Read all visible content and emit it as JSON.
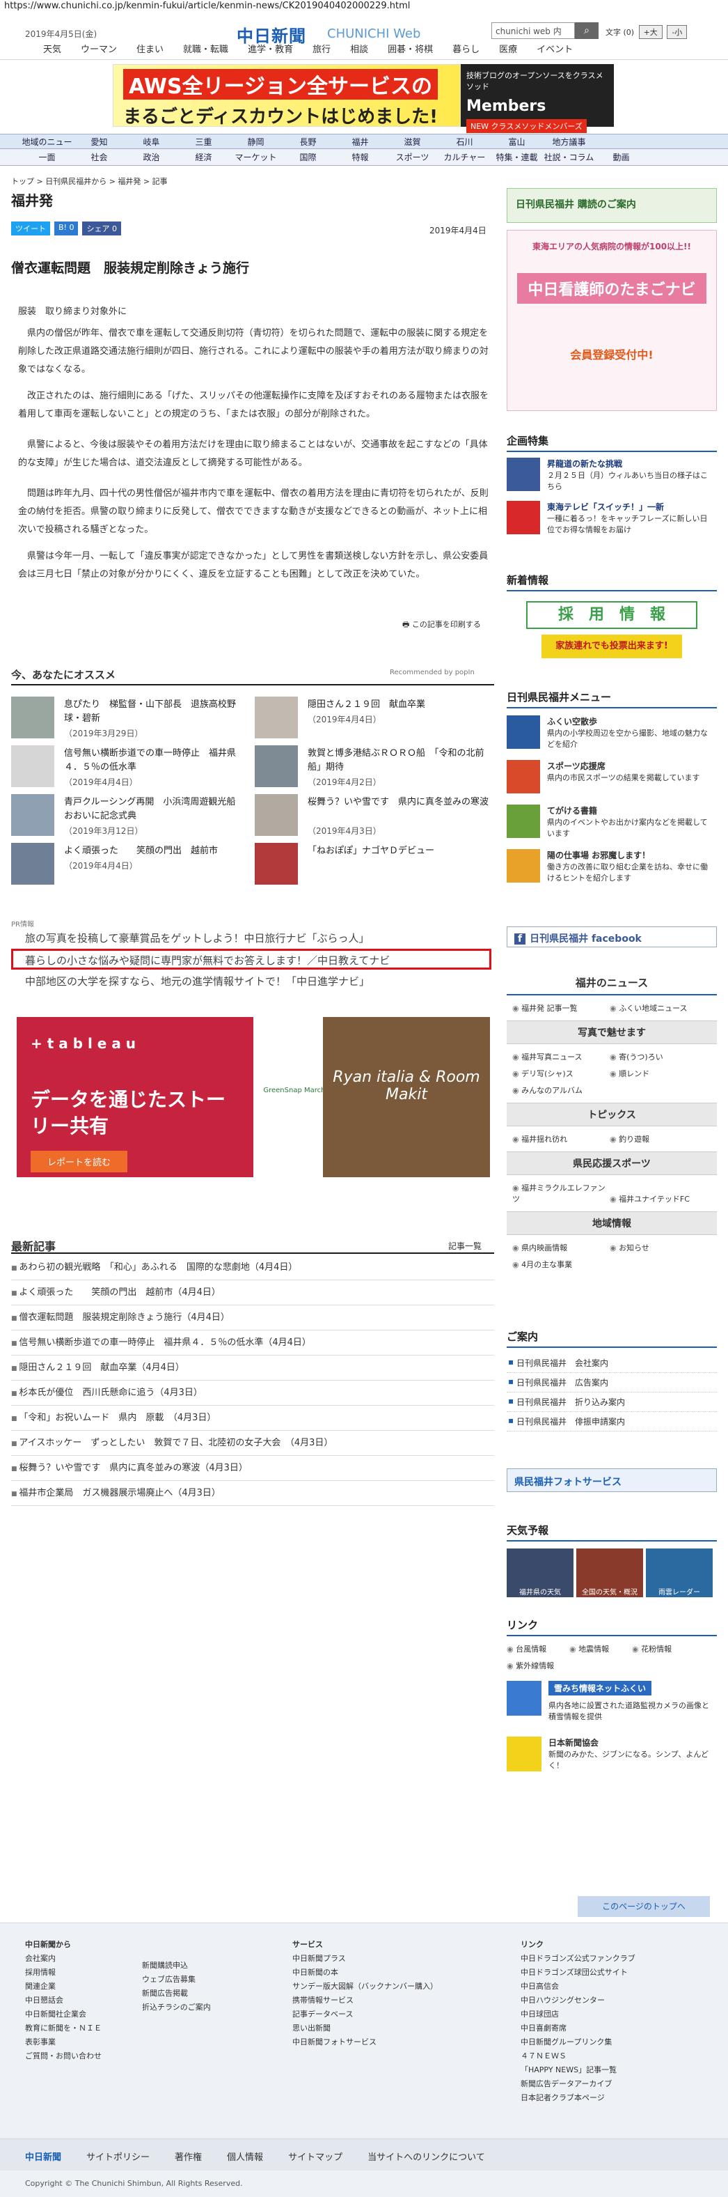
{
  "url": "https://www.chunichi.co.jp/kenmin-fukui/article/kenmin-news/CK2019040402000229.html",
  "header": {
    "date": "2019年4月5日(金)",
    "logo": "中日新聞",
    "logo_sub": "CHUNICHI Web",
    "search_placeholder": "chunichi web 内",
    "search_icon": "search-icon",
    "fontsize_label": "文字",
    "fontsize_current": "(0)",
    "fontsize_plus": "+大",
    "fontsize_minus": "-小",
    "nav": [
      "天気",
      "ウーマン",
      "住まい",
      "就職・転職",
      "進学・教育",
      "旅行",
      "相談",
      "囲碁・将棋",
      "暮らし",
      "医療",
      "イベント"
    ]
  },
  "banner": {
    "line1": "AWS全リージョン全サービスの",
    "line2": "まるごとディスカウントはじめました!",
    "r1": "技術ブログのオープンソースをクラスメソッド",
    "r2": "Members",
    "r3": "NEW クラスメソッドメンバーズ",
    "accent": "#e52b18"
  },
  "catnav1": [
    "地域のニュース",
    "愛知",
    "岐阜",
    "三重",
    "静岡",
    "長野",
    "福井",
    "滋賀",
    "石川",
    "富山",
    "地方議事"
  ],
  "catnav2": [
    "一面",
    "社会",
    "政治",
    "経済",
    "マーケット",
    "国際",
    "特報",
    "スポーツ",
    "カルチャー",
    "特集・連載",
    "社説・コラム",
    "動画"
  ],
  "breadcrumb": "トップ > 日刊県民福井から > 福井発 > 記事",
  "section_title": "福井発",
  "share": {
    "tweet": "ツイート",
    "hatena": "B! 0",
    "facebook": "シェア 0"
  },
  "article": {
    "date": "2019年4月4日",
    "headline": "僧衣運転問題　服装規定削除きょう施行",
    "subhead": "服装　取り締まり対象外に",
    "paragraphs": [
      "県内の僧侶が昨年、僧衣で車を運転して交通反則切符（青切符）を切られた問題で、運転中の服装に関する規定を削除した改正県道路交通法施行細則が四日、施行される。これにより運転中の服装や手の着用方法が取り締まりの対象ではなくなる。",
      "改正されたのは、施行細則にある「げた、スリッパその他運転操作に支障を及ぼすおそれのある履物または衣服を着用して車両を運転しないこと」との規定のうち、「または衣服」の部分が削除された。",
      "県警によると、今後は服装やその着用方法だけを理由に取り締まることはないが、交通事故を起こすなどの「具体的な支障」が生じた場合は、道交法違反として摘発する可能性がある。",
      "問題は昨年九月、四十代の男性僧侶が福井市内で車を運転中、僧衣の着用方法を理由に青切符を切られたが、反則金の納付を拒否。県警の取り締まりに反発して、僧衣でできますな動きが支援などできるとの動画が、ネット上に相次いで投稿される騒ぎとなった。",
      "県警は今年一月、一転して「違反事実が認定できなかった」として男性を書類送検しない方針を示し、県公安委員会は三月七日「禁止の対象が分かりにくく、違反を立証することも困難」として改正を決めていた。"
    ],
    "print": "この記事を印刷する"
  },
  "recommend": {
    "title": "今、あなたにオススメ",
    "by": "Recommended by popIn",
    "items": [
      {
        "title": "息ぴたり　梯監督・山下部長　退族高校野球・碧新",
        "date": "（2019年3月29日）"
      },
      {
        "title": "隠田さん２１９回　献血卒業",
        "date": "（2019年4月4日）"
      },
      {
        "title": "信号無い横断歩道での車一時停止　福井県４．５％の低水準",
        "date": "（2019年4月4日）"
      },
      {
        "title": "敦賀と博多港結ぶＲＯＲＯ船　「令和の北前船」期待",
        "date": "（2019年4月2日）"
      },
      {
        "title": "青戸クルーシング再開　小浜湾周遊観光船　おおいに記念式典",
        "date": "（2019年3月12日）"
      },
      {
        "title": "桜舞う？いや雪です　県内に真冬並みの寒波",
        "date": "（2019年4月3日）"
      },
      {
        "title": "よく頑張った　　笑顔の門出　越前市",
        "date": "（2019年4月4日）"
      },
      {
        "title": "「ねおぽぽ」ナゴヤＤデビュー",
        "date": ""
      }
    ]
  },
  "pr": {
    "label": "PR情報",
    "items": [
      "旅の写真を投稿して豪華賞品をゲットしよう！中日旅行ナビ「ぶらっ人」",
      "暮らしの小さな悩みや疑問に専門家が無料でお答えします！／中日教えてナビ",
      "中部地区の大学を探すなら、地元の進学情報サイトで！「中日進学ナビ」"
    ]
  },
  "ads": {
    "a1_brand": "+ t a b l e a u",
    "a1_text": "データを通じたストーリー共有",
    "a1_btn": "レポートを読む",
    "a2_text": "GreenSnap Marche",
    "a3_text": "Ryan italia & Room Makit"
  },
  "latest": {
    "title": "最新記事",
    "more": "記事一覧",
    "items": [
      "あわら初の観光戦略　「和心」あふれる　国際的な悲劇地（4月4日）",
      "よく頑張った　　笑顔の門出　越前市（4月4日）",
      "僧衣運転問題　服装規定削除きょう施行（4月4日）",
      "信号無い横断歩道での車一時停止　福井県４．５％の低水準（4月4日）",
      "隠田さん２１９回　献血卒業（4月4日）",
      "杉本氏が優位　西川氏懸命に追う（4月3日）",
      "「令和」お祝いムード　県内　原載　（4月3日）",
      "アイスホッケー　ずっとしたい　敦賀で７日、北陸初の女子大会　（4月3日）",
      "桜舞う？いや雪です　県内に真冬並みの寒波（4月3日）",
      "福井市企業局　ガス機器展示場廃止へ（4月3日）"
    ]
  },
  "sidebar": {
    "subscribe": "日刊県民福井 購読のご案内",
    "nurse_ad": "中日看護師のたまごナビ",
    "nurse_sub": "東海エリアの人気病院の情報が100以上!!",
    "nurse_reg": "会員登録受付中!",
    "kikaku_title": "企画特集",
    "kikaku_items": [
      {
        "title": "昇龍道の新たな挑戦",
        "desc": "２月２５日（月）ウィルあいち当日の様子はこちら"
      },
      {
        "title": "東海テレビ「スイッチ！」一新",
        "desc": "一種に着るっ！をキャッチフレーズに新しい日位でお得な情報をお届け"
      }
    ],
    "recruit_title": "新着情報",
    "recruit_text": "採　用　情　報",
    "recruit_sub": "家族連れでも投票出来ます!",
    "menu_title": "日刊県民福井メニュー",
    "menu_items": [
      {
        "title": "ふくい空散歩",
        "desc": "県内の小学校周辺を空から撮影、地域の魅力などを紹介"
      },
      {
        "title": "スポーツ応援席",
        "desc": "県内の市民スポーツの結果を掲載しています"
      },
      {
        "title": "てがける書籍",
        "desc": "県内のイベントやお出かけ案内などを掲載しています"
      },
      {
        "title": "陽の仕事場 お邪魔します！",
        "desc": "働き方の改善に取り組む企業を訪ね、幸せに働けるヒントを紹介します"
      }
    ],
    "facebook": "日刊県民福井 facebook",
    "fukui_news": "福井のニュース",
    "fukui_chk": [
      "福井発 記事一覧",
      "ふくい地域ニュース"
    ],
    "photo_title": "写真で魅せます",
    "photo_chk": [
      "福井写真ニュース",
      "寄(うつ)ろい",
      "デリ写(シャ)ス",
      "順レンド",
      "みんなのアルバム"
    ],
    "topics_title": "トピックス",
    "topics_chk": [
      "福井揺れ彷れ",
      "釣り遊報"
    ],
    "sports_title": "県民応援スポーツ",
    "sports_chk": [
      "福井ミラクルエレファンツ",
      "福井ユナイテッドFC"
    ],
    "region_title": "地域情報",
    "region_chk": [
      "県内映画情報",
      "お知らせ",
      "4月の主な事業"
    ],
    "guide_title": "ご案内",
    "guide_items": [
      "日刊県民福井　会社案内",
      "日刊県民福井　広告案内",
      "日刊県民福井　折り込み案内",
      "日刊県民福井　俳振申請案内"
    ],
    "photo_service": "県民福井フォトサービス",
    "weather_title": "天気予報",
    "weather_imgs": [
      "福井県の天気",
      "全国の天気・概況",
      "雨雲レーダー"
    ],
    "link_title": "リンク",
    "link_chk": [
      "台風情報",
      "地震情報",
      "花粉情報",
      "紫外線情報"
    ],
    "road_title": "雪みち情報ネットふくい",
    "road_desc": "県内各地に設置された道路監視カメラの画像と積雪情報を提供",
    "jnpa_title": "日本新聞協会",
    "jnpa_desc": "新聞のみかた、ジブンになる。シンプ、よんどく！"
  },
  "footer": {
    "totop": "このページのトップへ",
    "col1_title": "中日新聞から",
    "col1": [
      "会社案内",
      "採用情報",
      "関連企業",
      "中日懇話会",
      "中日新聞社企業会",
      "教育に新聞を・ＮＩＥ",
      "表彰事業",
      "ご質問・お問い合わせ"
    ],
    "col2": [
      "新聞購読申込",
      "ウェブ広告募集",
      "新聞広告掲載",
      "折込チラシのご案内"
    ],
    "col3_title": "サービス",
    "col3": [
      "中日新聞プラス",
      "中日新聞の本",
      "サンデー版大図解（バックナンバー購入）",
      "携帯情報サービス",
      "記事データベース",
      "思い出新聞",
      "中日新聞フォトサービス"
    ],
    "col4_title": "リンク",
    "col4": [
      "中日ドラゴンズ公式ファンクラブ",
      "中日ドラゴンズ球団公式サイト",
      "中日高信会",
      "中日ハウジングセンター",
      "中日球団店",
      "中日喜劇寄席",
      "中日新聞グループリンク集",
      "４７ＮＥＷＳ",
      "「HAPPY NEWS」記事一覧",
      "新聞広告データアーカイブ",
      "日本記者クラブ本ページ"
    ],
    "bar_logo": "中日新聞",
    "bar_links": [
      "サイトポリシー",
      "著作権",
      "個人情報",
      "サイトマップ",
      "当サイトへのリンクについて"
    ],
    "copyright": "Copyright © The Chunichi Shimbun, All Rights Reserved."
  }
}
